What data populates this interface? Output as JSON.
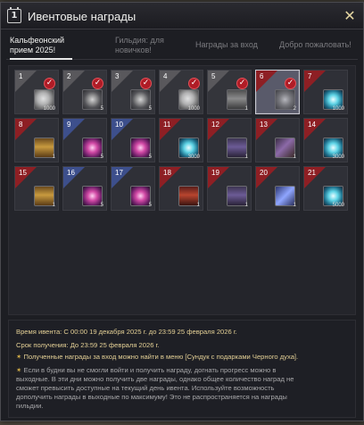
{
  "window": {
    "title": "Ивентовые награды",
    "title_icon": "calendar-icon",
    "close_icon": "close-x-icon"
  },
  "tabs": [
    {
      "label": "Кальфеонский прием 2025!",
      "active": true
    },
    {
      "label": "Гильдия: для новичков!",
      "active": false
    },
    {
      "label": "Награды за вход",
      "active": false
    },
    {
      "label": "Добро пожаловать!",
      "active": false
    }
  ],
  "days": [
    {
      "day": "1",
      "icon": "silver-coin-icon",
      "qty": "1000",
      "claimed": true,
      "corner": "grey"
    },
    {
      "day": "2",
      "icon": "swirl-stone-icon",
      "qty": "5",
      "claimed": true,
      "corner": "grey"
    },
    {
      "day": "3",
      "icon": "swirl-stone-icon",
      "qty": "5",
      "claimed": true,
      "corner": "grey"
    },
    {
      "day": "4",
      "icon": "silver-coin-icon",
      "qty": "1000",
      "claimed": true,
      "corner": "grey"
    },
    {
      "day": "5",
      "icon": "gray-box-icon",
      "qty": "1",
      "claimed": true,
      "corner": "grey"
    },
    {
      "day": "6",
      "icon": "gray-stone-icon",
      "qty": "2",
      "claimed": true,
      "corner": "red",
      "today": true
    },
    {
      "day": "7",
      "icon": "cyan-crystal-icon",
      "qty": "1000",
      "claimed": false,
      "corner": "red"
    },
    {
      "day": "8",
      "icon": "gold-chest-icon",
      "qty": "1",
      "claimed": false,
      "corner": "red"
    },
    {
      "day": "9",
      "icon": "purple-swirl-icon",
      "qty": "5",
      "claimed": false,
      "corner": "blue"
    },
    {
      "day": "10",
      "icon": "purple-swirl-icon",
      "qty": "5",
      "claimed": false,
      "corner": "blue"
    },
    {
      "day": "11",
      "icon": "cyan-crystal-icon",
      "qty": "3000",
      "claimed": false,
      "corner": "red"
    },
    {
      "day": "12",
      "icon": "dark-chest-icon",
      "qty": "1",
      "claimed": false,
      "corner": "red"
    },
    {
      "day": "13",
      "icon": "gun-icon",
      "qty": "1",
      "claimed": false,
      "corner": "red"
    },
    {
      "day": "14",
      "icon": "cyan-crystal-icon",
      "qty": "3000",
      "claimed": false,
      "corner": "red"
    },
    {
      "day": "15",
      "icon": "gold-chest-icon",
      "qty": "1",
      "claimed": false,
      "corner": "red"
    },
    {
      "day": "16",
      "icon": "purple-swirl-icon",
      "qty": "5",
      "claimed": false,
      "corner": "blue"
    },
    {
      "day": "17",
      "icon": "purple-swirl-icon",
      "qty": "5",
      "claimed": false,
      "corner": "blue"
    },
    {
      "day": "18",
      "icon": "red-chest-icon",
      "qty": "1",
      "claimed": false,
      "corner": "red"
    },
    {
      "day": "19",
      "icon": "dark-chest-icon",
      "qty": "1",
      "claimed": false,
      "corner": "red"
    },
    {
      "day": "20",
      "icon": "blue-crystal-icon",
      "qty": "1",
      "claimed": false,
      "corner": "red"
    },
    {
      "day": "21",
      "icon": "cyan-crystal-icon",
      "qty": "5000",
      "claimed": false,
      "corner": "red"
    }
  ],
  "info": {
    "event_time": "Время ивента: С 00:00 19 декабря 2025 г. до 23:59 25 февраля 2026 г.",
    "receive_deadline": "Срок получения: До 23:59 25 февраля 2026 г.",
    "mail_note": "Полученные награды за вход можно найти в меню [Сундук с подарками Черного духа].",
    "weekday_note_1": "Если в будни вы не смогли войти и получить награду, догнать прогресс можно в",
    "weekday_note_2": "выходные. В эти дни можно получить две награды, однако общее количество наград не",
    "weekday_note_3": "сможет превысить доступные на текущий день ивента. Используйте возможность",
    "weekday_note_4": "дополучить награды в выходные по максимуму! Это не распространяется на награды",
    "weekday_note_5": "гильдии.",
    "bullet_icon": "star-bullet-icon"
  },
  "colors": {
    "claimed_check": "#b01c26",
    "corner_red": "#8e1f24",
    "corner_blue": "#3d4f8c",
    "info_text": "#e3cf95"
  }
}
